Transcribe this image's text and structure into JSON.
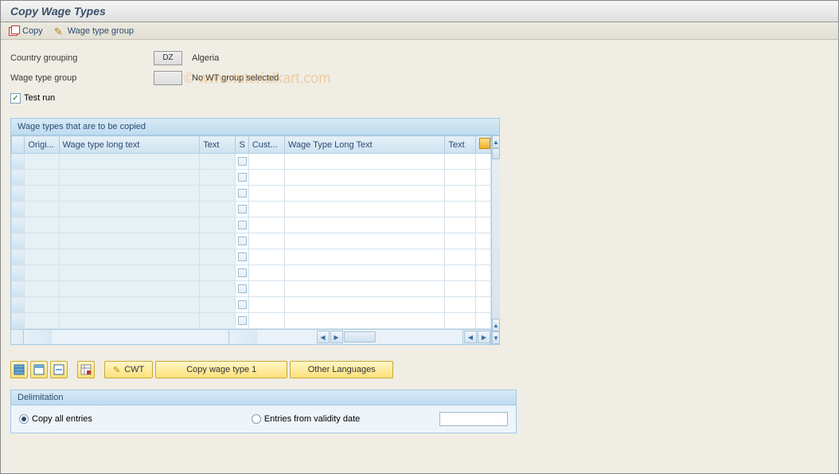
{
  "title": "Copy Wage Types",
  "watermark": "© www.tutorialkart.com",
  "toolbar": {
    "copy": "Copy",
    "wage_type_group": "Wage type group"
  },
  "fields": {
    "country_grouping_label": "Country grouping",
    "country_grouping_value": "DZ",
    "country_grouping_text": "Algeria",
    "wage_type_group_label": "Wage type group",
    "wage_type_group_value": "",
    "wage_type_group_text": "No WT group selected",
    "test_run_label": "Test run",
    "test_run_checked": "✓"
  },
  "grid": {
    "title": "Wage types that are to be copied",
    "columns": {
      "origi": "Origi...",
      "wtlt": "Wage type long text",
      "text1": "Text",
      "s": "S",
      "cust": "Cust...",
      "wtlt2": "Wage Type Long Text",
      "text2": "Text"
    }
  },
  "buttons": {
    "cwt": "CWT",
    "copy_wt1": "Copy wage type 1",
    "other_lang": "Other Languages"
  },
  "delimitation": {
    "title": "Delimitation",
    "copy_all": "Copy all entries",
    "entries_from": "Entries from validity date"
  }
}
